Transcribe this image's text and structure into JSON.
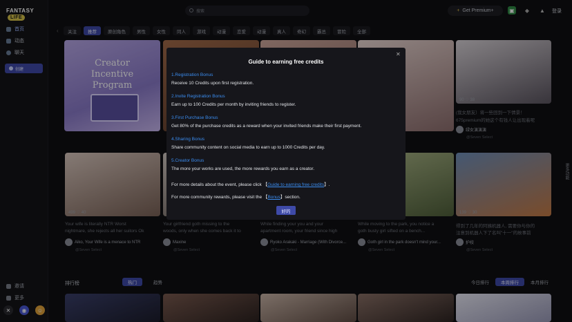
{
  "app": {
    "logo_text": "FANTASY",
    "logo_pill": "LIFE"
  },
  "sidebar": {
    "items": [
      {
        "label": "首页"
      },
      {
        "label": "动态"
      },
      {
        "label": "聊天"
      }
    ],
    "create_button": "创建",
    "footer": [
      {
        "label": "邀请"
      },
      {
        "label": "更多"
      }
    ]
  },
  "topbar": {
    "search_placeholder": "搜索",
    "premium_label": "Get Premium+",
    "login_label": "登录"
  },
  "tabs": [
    "关注",
    "推荐",
    "原创角色",
    "男性",
    "女性",
    "同人",
    "游戏",
    "动漫",
    "恋爱",
    "动漫",
    "真人",
    "奇幻",
    "霸总",
    "冒险",
    "全部"
  ],
  "tabs_active_index": 1,
  "promo": {
    "title_lines": [
      "Creator",
      "Incentive",
      "Program"
    ]
  },
  "cards_top": [
    {
      "likes": "90",
      "comments": "38",
      "caption": "(我女朋友）将一些回到一下情景！",
      "caption2": "675premium的她这个有钱人让出现着呢",
      "author": "绿女演演演",
      "sub": "@Seven Select"
    }
  ],
  "cards_mid": [
    {
      "likes": "499",
      "comments": "40",
      "caption": "Your wife is literally NTR Worst",
      "caption2": "nightmare, she rejects all her suitors Ok",
      "author": "Aiko, Your Wife is a menace to NTR",
      "sub": "@Seven Select"
    },
    {
      "caption": "Your girlfriend goth missing to the",
      "caption2": "woods, only when she comes back it to",
      "author": "Maxine",
      "sub": "@Seven Select"
    },
    {
      "caption": "While finding your you and your",
      "caption2": "apartment room, your friend since high ",
      "author": "Ryoko Arakaki - Marriage (With Divorce...",
      "sub": "@Seven Select"
    },
    {
      "caption": "While moving to the park, you notice a",
      "caption2": "goth busty girl sifted on a bench...",
      "author": "Goth girl in the park doesn't mind your...",
      "sub": "@Seven Select"
    },
    {
      "likes": "139",
      "comments": "30",
      "caption": "得到了几年的阿姨机器人, 需要你与你的",
      "caption2": "注意到机器人下了名叫\"十一\"的故事前",
      "author": "护校",
      "sub": "@Seven Select"
    }
  ],
  "shelf": {
    "title": "排行榜",
    "tabs": [
      "热门",
      "趋势"
    ],
    "right_tabs": [
      "今日排行",
      "本周排行",
      "本月排行"
    ]
  },
  "modal": {
    "title": "Guide to earning free credits",
    "sections": [
      {
        "heading": "1.Registration Bonus",
        "text": "Receive 10 Credits upon first registration."
      },
      {
        "heading": "2.Invite Registration Bonus",
        "text": "Earn up to 100 Credits per month by inviting friends to register."
      },
      {
        "heading": "3.First Purchase Bonus",
        "text": "Get 80% of the purchase credits as a reward when your invited friends make their first payment."
      },
      {
        "heading": "4.Sharing Bonus",
        "text": "Share community content on social media to earn up to 1000 Credits per day."
      },
      {
        "heading": "5.Creator Bonus",
        "text": "The more your works are used, the more rewards you earn as a creator."
      }
    ],
    "details_prefix": "For more details about the event, please click 【",
    "details_link": "Guide to earning free credits",
    "details_suffix": "】.",
    "community_prefix": "For more community rewards, please visit the 【",
    "community_link": "Bonus",
    "community_suffix": "】section.",
    "ok_label": "好的"
  },
  "side_tag": "更多功能",
  "colors": {
    "accent": "#3e4aa8",
    "link": "#3b8df0"
  }
}
